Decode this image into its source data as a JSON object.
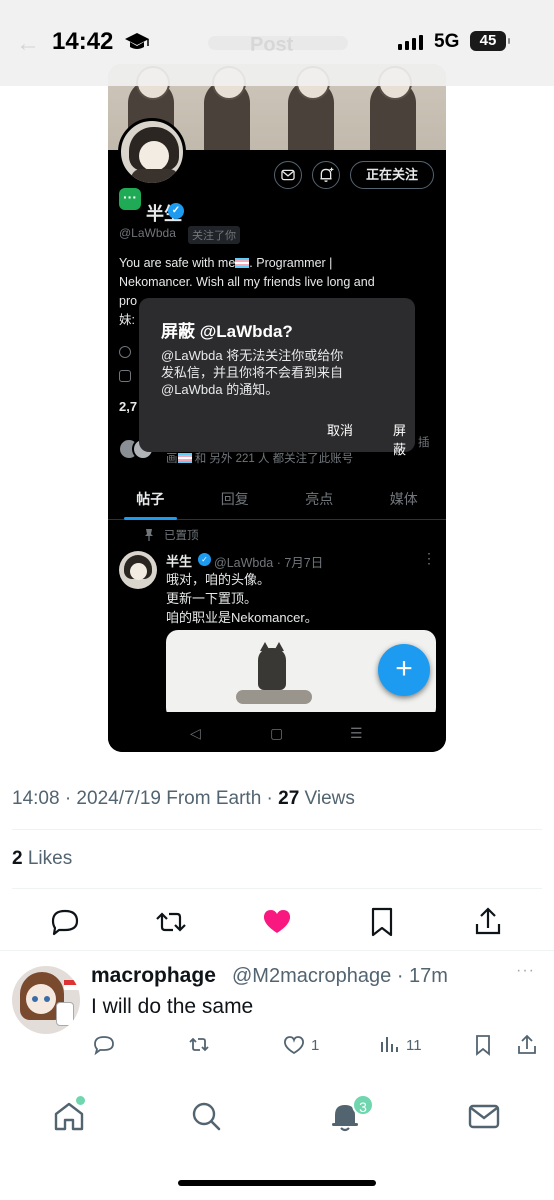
{
  "status_bar": {
    "time": "14:42",
    "network": "5G",
    "battery": "45"
  },
  "embedded": {
    "profile": {
      "name": "半生",
      "handle": "@LaWbda",
      "follows_you": "关注了你",
      "following_button": "正在关注",
      "bio_line1": "You are safe with me",
      "bio_line1b": ". Programmer |",
      "bio_line2": "Nekomancer. Wish all my friends live long and",
      "bio_line3": "pro",
      "bio_line4": "妹:",
      "stat_partial": "2,7",
      "followed_by_tail": "画",
      "followed_by_text": " 和 另外 221 人 都关注了此账号",
      "followed_by_end": "插"
    },
    "tabs": [
      {
        "label": "帖子"
      },
      {
        "label": "回复"
      },
      {
        "label": "亮点"
      },
      {
        "label": "媒体"
      }
    ],
    "pinned_label": "已置顶",
    "pinned_tweet": {
      "name": "半生",
      "handle_date": "@LaWbda · 7月7日",
      "line1": "哦对，咱的头像。",
      "line2": "更新一下置顶。",
      "line3": "咱的职业是Nekomancer。"
    },
    "dialog": {
      "title": "屏蔽 @LaWbda?",
      "body_line1": "@LaWbda 将无法关注你或给你",
      "body_line2": "发私信，并且你将不会看到来自",
      "body_line3": "@LaWbda 的通知。",
      "cancel": "取消",
      "confirm": "屏蔽"
    },
    "fab_label": "+"
  },
  "tweet_meta": {
    "time_date": "14:08 · 2024/7/19 From Earth · ",
    "views_count": "27",
    "views_label": " Views",
    "likes_count": "2",
    "likes_label": " Likes"
  },
  "colors": {
    "like_active": "#f91880",
    "accent": "#1d9bf0",
    "badge": "#6fd6b0"
  },
  "reply": {
    "name": "macrophage",
    "handle_time": "@M2macrophage · 17m",
    "text": "I will do the same",
    "likes": "1",
    "views": "11"
  },
  "bottom_nav": {
    "items": [
      {
        "icon": "home-icon"
      },
      {
        "icon": "search-icon"
      },
      {
        "icon": "notifications-icon"
      },
      {
        "icon": "messages-icon"
      }
    ],
    "notifications_badge": "3"
  }
}
